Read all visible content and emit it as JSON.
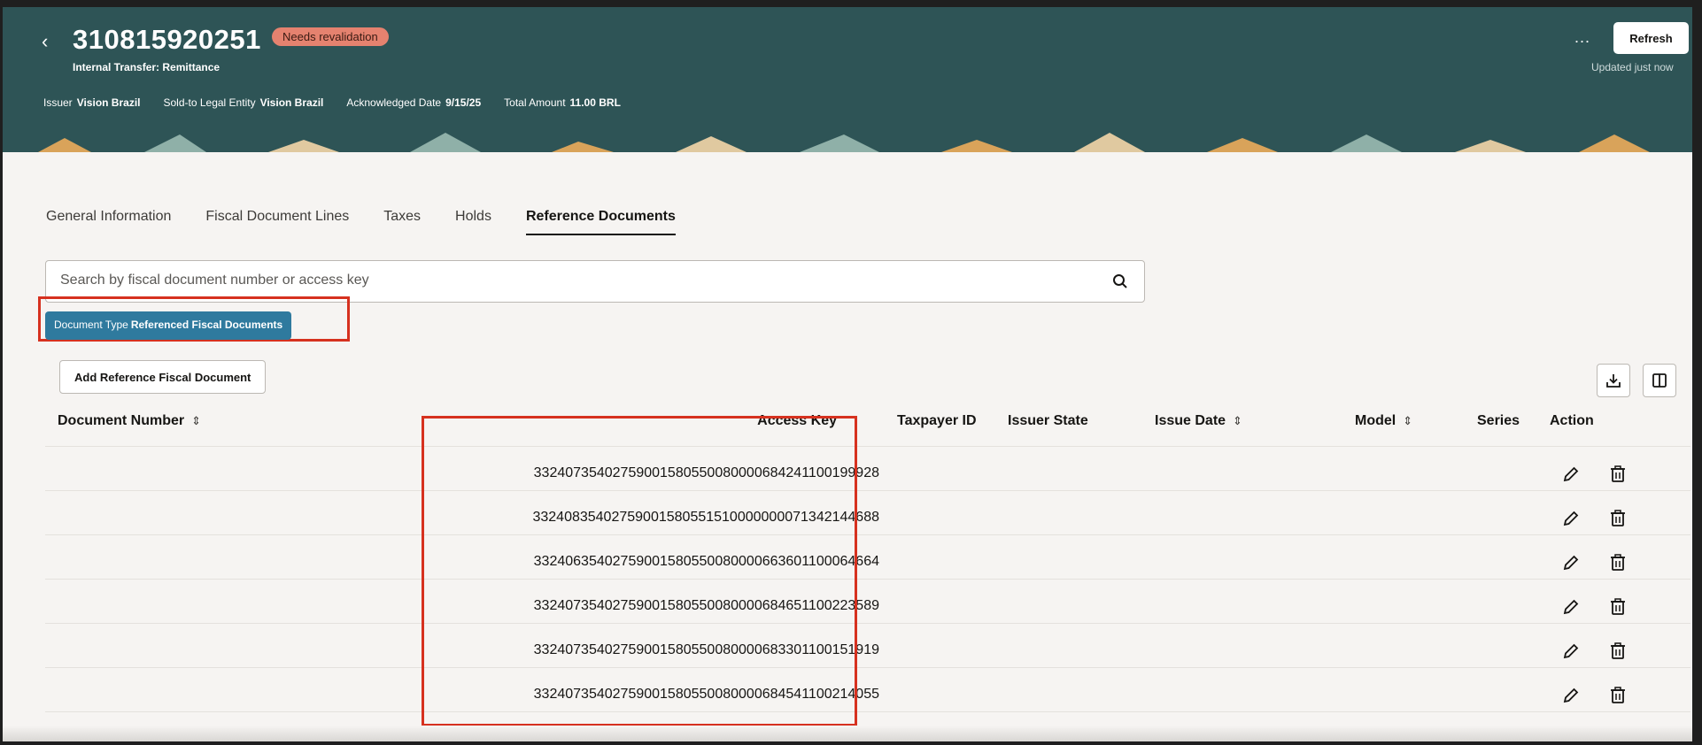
{
  "header": {
    "back_icon": "chevron-left-icon",
    "title": "310815920251",
    "status_badge": "Needs revalidation",
    "subtitle": "Internal Transfer: Remittance",
    "meta": [
      {
        "label": "Issuer",
        "value": "Vision Brazil"
      },
      {
        "label": "Sold-to Legal Entity",
        "value": "Vision Brazil"
      },
      {
        "label": "Acknowledged Date",
        "value": "9/15/25"
      },
      {
        "label": "Total Amount",
        "value": "11.00 BRL"
      }
    ],
    "more_icon": "...",
    "refresh_label": "Refresh",
    "updated_text": "Updated just now"
  },
  "tabs": [
    {
      "label": "General Information",
      "active": false
    },
    {
      "label": "Fiscal Document Lines",
      "active": false
    },
    {
      "label": "Taxes",
      "active": false
    },
    {
      "label": "Holds",
      "active": false
    },
    {
      "label": "Reference Documents",
      "active": true
    }
  ],
  "search": {
    "placeholder": "Search by fiscal document number or access key",
    "value": "",
    "icon": "search-icon"
  },
  "filter_chip": {
    "label": "Document Type",
    "value": "Referenced Fiscal Documents"
  },
  "toolbar": {
    "add_label": "Add Reference Fiscal Document",
    "download_icon": "download-icon",
    "columns_icon": "columns-icon"
  },
  "table": {
    "columns": [
      "Document Number",
      "Access Key",
      "Taxpayer ID",
      "Issuer State",
      "Issue Date",
      "Model",
      "Series",
      "Action"
    ],
    "sortable": [
      "Document Number",
      "Issue Date",
      "Model"
    ],
    "rows": [
      {
        "document_number": "",
        "access_key": "33240735402759001580550080000684241100199928"
      },
      {
        "document_number": "",
        "access_key": "33240835402759001580551510000000071342144688"
      },
      {
        "document_number": "",
        "access_key": "33240635402759001580550080000663601100064664"
      },
      {
        "document_number": "",
        "access_key": "33240735402759001580550080000684651100223589"
      },
      {
        "document_number": "",
        "access_key": "33240735402759001580550080000683301100151919"
      },
      {
        "document_number": "",
        "access_key": "33240735402759001580550080000684541100214055"
      }
    ],
    "row_actions": [
      "edit-icon",
      "delete-icon"
    ]
  },
  "highlight_color": "#d6311f",
  "header_color": "#2e5456",
  "chip_color": "#2f7a9e",
  "badge_color": "#e5826f"
}
